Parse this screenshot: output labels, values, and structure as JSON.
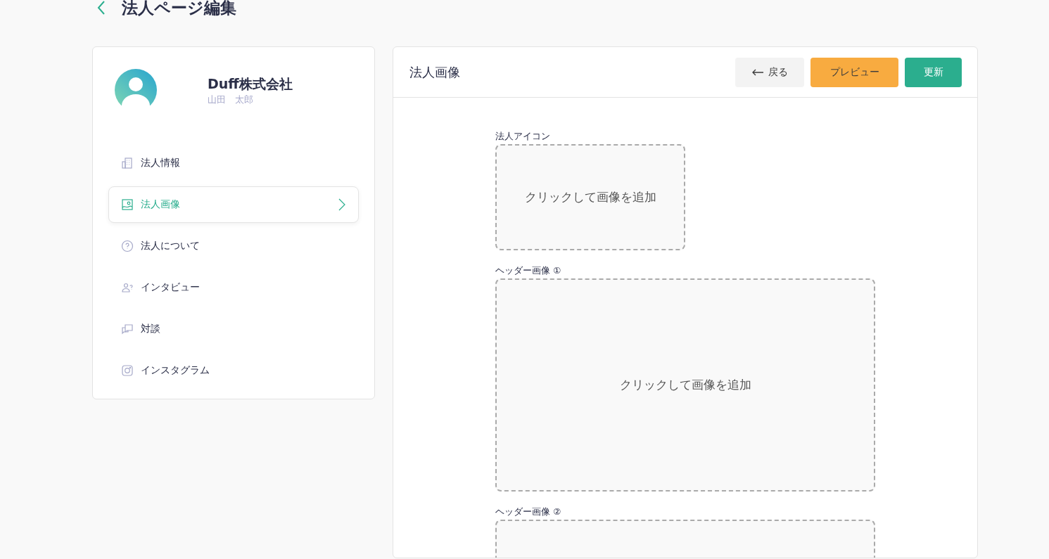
{
  "page_title": "法人ページ編集",
  "profile": {
    "company": "Duff株式会社",
    "person": "山田　太郎"
  },
  "nav": [
    {
      "label": "法人情報",
      "kind": "building",
      "selected": false
    },
    {
      "label": "法人画像",
      "kind": "image",
      "selected": true
    },
    {
      "label": "法人について",
      "kind": "question",
      "selected": false
    },
    {
      "label": "インタビュー",
      "kind": "interview",
      "selected": false
    },
    {
      "label": "対談",
      "kind": "chat",
      "selected": false
    },
    {
      "label": "インスタグラム",
      "kind": "instagram",
      "selected": false
    }
  ],
  "panel": {
    "title": "法人画像",
    "buttons": [
      {
        "label": "戻る",
        "kind": "back"
      },
      {
        "label": "プレビュー",
        "kind": "preview"
      },
      {
        "label": "更新",
        "kind": "update"
      }
    ],
    "slots": [
      {
        "label": "法人アイコン",
        "kind": "icon",
        "placeholder": "クリックして画像を追加"
      },
      {
        "label": "ヘッダー画像 ①",
        "kind": "header",
        "placeholder": "クリックして画像を追加"
      },
      {
        "label": "ヘッダー画像 ②",
        "kind": "header"
      }
    ]
  }
}
